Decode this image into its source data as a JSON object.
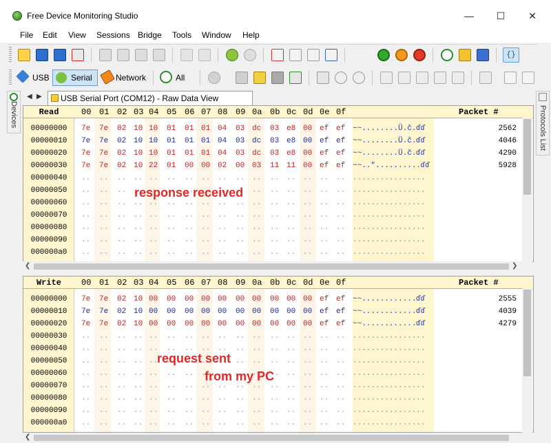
{
  "window": {
    "title": "Free Device Monitoring Studio"
  },
  "menu": [
    "File",
    "Edit",
    "View",
    "Sessions",
    "Bridge",
    "Tools",
    "Window",
    "Help"
  ],
  "toolbar2": {
    "usb": "USB",
    "serial": "Serial",
    "network": "Network",
    "all": "All"
  },
  "sidebars": {
    "left": "Devices",
    "right": "Protocols List"
  },
  "tab": {
    "label": "USB Serial Port (COM12) - Raw Data View"
  },
  "header": {
    "cols": [
      "00",
      "01",
      "02",
      "03",
      "04",
      "05",
      "06",
      "07",
      "08",
      "09",
      "0a",
      "0b",
      "0c",
      "0d",
      "0e",
      "0f"
    ],
    "packet_label": "Packet #"
  },
  "read": {
    "label": "Read",
    "rows": [
      {
        "addr": "00000000",
        "bytes": [
          "7e",
          "7e",
          "02",
          "10",
          "10",
          "01",
          "01",
          "01",
          "04",
          "03",
          "dc",
          "03",
          "e8",
          "00",
          "ef",
          "ef"
        ],
        "ascii": "~~........Ü.č.ďď",
        "packet": "2562",
        "color": "red"
      },
      {
        "addr": "00000010",
        "bytes": [
          "7e",
          "7e",
          "02",
          "10",
          "10",
          "01",
          "01",
          "01",
          "04",
          "03",
          "dc",
          "03",
          "e8",
          "00",
          "ef",
          "ef"
        ],
        "ascii": "~~........Ü.č.ďď",
        "packet": "4046",
        "color": "blue"
      },
      {
        "addr": "00000020",
        "bytes": [
          "7e",
          "7e",
          "02",
          "10",
          "10",
          "01",
          "01",
          "01",
          "04",
          "03",
          "dc",
          "03",
          "e8",
          "00",
          "ef",
          "ef"
        ],
        "ascii": "~~........Ü.č.ďď",
        "packet": "4290",
        "color": "red"
      },
      {
        "addr": "00000030",
        "bytes": [
          "7e",
          "7e",
          "02",
          "10",
          "22",
          "01",
          "00",
          "00",
          "02",
          "00",
          "03",
          "11",
          "11",
          "00",
          "ef",
          "ef"
        ],
        "ascii": "~~..\"..........ďď",
        "packet": "5928",
        "color": "red"
      },
      {
        "addr": "00000040"
      },
      {
        "addr": "00000050"
      },
      {
        "addr": "00000060"
      },
      {
        "addr": "00000070"
      },
      {
        "addr": "00000080"
      },
      {
        "addr": "00000090"
      },
      {
        "addr": "000000a0"
      }
    ]
  },
  "write": {
    "label": "Write",
    "rows": [
      {
        "addr": "00000000",
        "bytes": [
          "7e",
          "7e",
          "02",
          "10",
          "00",
          "00",
          "00",
          "00",
          "00",
          "00",
          "00",
          "00",
          "00",
          "00",
          "ef",
          "ef"
        ],
        "ascii": "~~............ďď",
        "packet": "2555",
        "color": "red"
      },
      {
        "addr": "00000010",
        "bytes": [
          "7e",
          "7e",
          "02",
          "10",
          "00",
          "00",
          "00",
          "00",
          "00",
          "00",
          "00",
          "00",
          "00",
          "00",
          "ef",
          "ef"
        ],
        "ascii": "~~............ďď",
        "packet": "4039",
        "color": "blue"
      },
      {
        "addr": "00000020",
        "bytes": [
          "7e",
          "7e",
          "02",
          "10",
          "00",
          "00",
          "00",
          "00",
          "00",
          "00",
          "00",
          "00",
          "00",
          "00",
          "ef",
          "ef"
        ],
        "ascii": "~~............ďď",
        "packet": "4279",
        "color": "red"
      },
      {
        "addr": "00000030"
      },
      {
        "addr": "00000040"
      },
      {
        "addr": "00000050"
      },
      {
        "addr": "00000060"
      },
      {
        "addr": "00000070"
      },
      {
        "addr": "00000080"
      },
      {
        "addr": "00000090"
      },
      {
        "addr": "000000a0"
      }
    ]
  },
  "annotations": {
    "response": "response received",
    "request_line1": "request sent",
    "request_line2": "from my PC"
  },
  "colors": {
    "red": "#d41616",
    "blue": "#1a2aa8",
    "annotation": "#e0282a",
    "header_bg": "#fff6cf"
  }
}
